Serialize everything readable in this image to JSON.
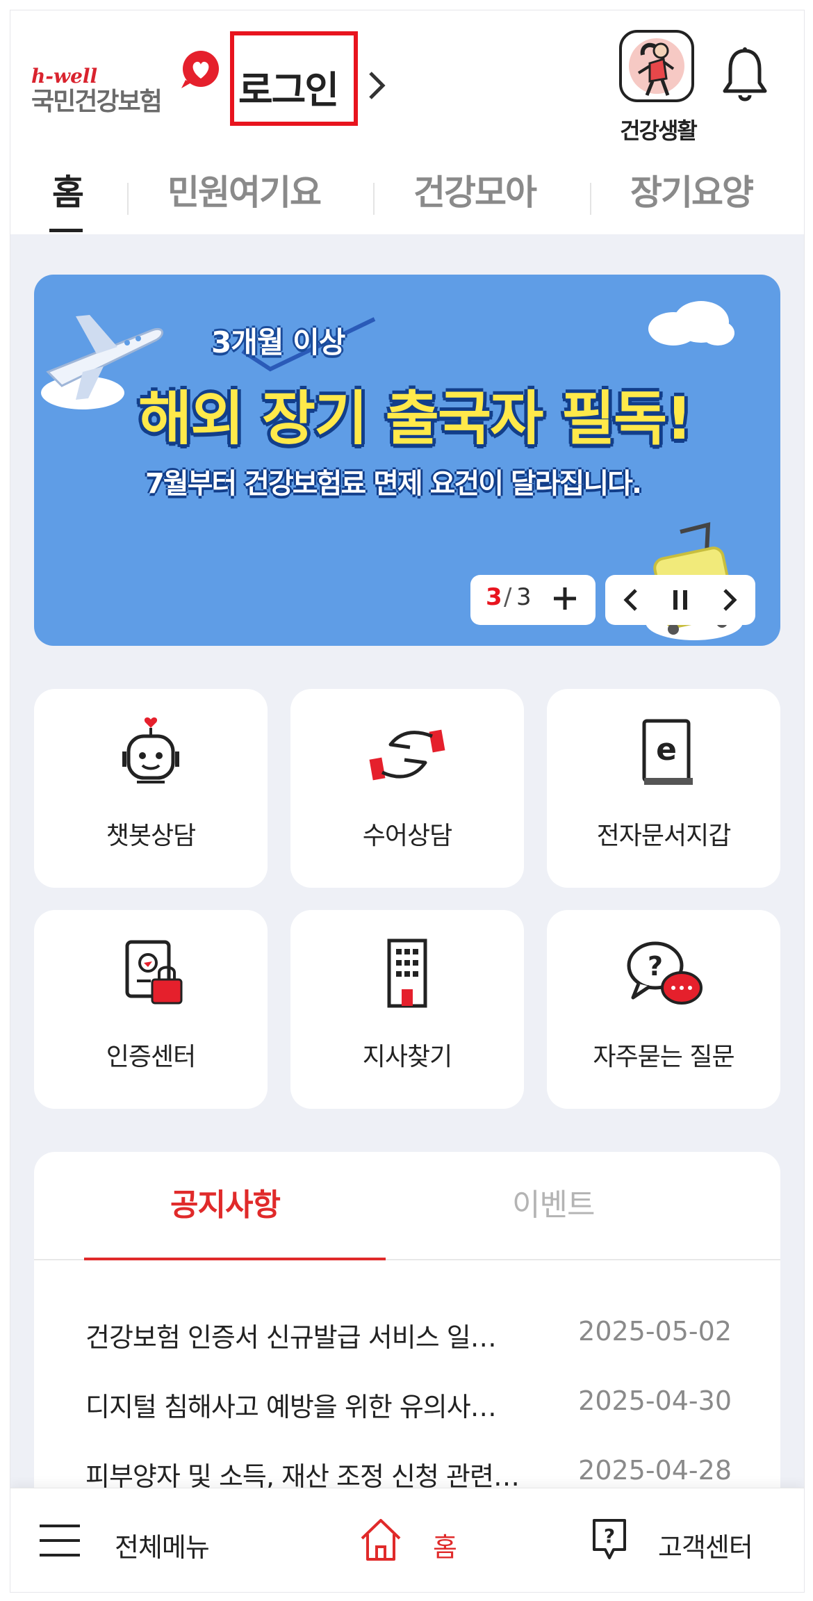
{
  "header": {
    "logo_tagline": "h-well",
    "logo_name": "국민건강보험",
    "login_label": "로그인",
    "health_life_label": "건강생활"
  },
  "tabs": [
    {
      "label": "홈",
      "active": true
    },
    {
      "label": "민원여기요",
      "active": false
    },
    {
      "label": "건강모아",
      "active": false
    },
    {
      "label": "장기요양",
      "active": false
    }
  ],
  "banner": {
    "subtitle": "3개월 이상",
    "title": "해외 장기 출국자 필독!",
    "description": "7월부터 건강보험료 면제 요건이 달라집니다.",
    "current_page": "3",
    "separator": "/",
    "total_pages": "3",
    "background_color": "#5f9de6",
    "title_color": "#ffe94a"
  },
  "quick_menu": [
    {
      "label": "챗봇상담",
      "icon": "chatbot-icon"
    },
    {
      "label": "수어상담",
      "icon": "sign-language-icon"
    },
    {
      "label": "전자문서지갑",
      "icon": "e-document-wallet-icon"
    },
    {
      "label": "인증센터",
      "icon": "certificate-lock-icon"
    },
    {
      "label": "지사찾기",
      "icon": "building-icon"
    },
    {
      "label": "자주묻는 질문",
      "icon": "faq-bubble-icon"
    }
  ],
  "notice": {
    "tabs": [
      {
        "label": "공지사항",
        "active": true
      },
      {
        "label": "이벤트",
        "active": false
      }
    ],
    "items": [
      {
        "title": "건강보험 인증서 신규발급 서비스 일…",
        "date": "2025-05-02"
      },
      {
        "title": "디지털 침해사고 예방을 위한 유의사…",
        "date": "2025-04-30"
      },
      {
        "title": "피부양자 및 소득, 재산 조정 신청 관련…",
        "date": "2025-04-28"
      }
    ]
  },
  "bottom_nav": {
    "menu_label": "전체메뉴",
    "home_label": "홈",
    "support_label": "고객센터"
  },
  "colors": {
    "accent_red": "#e02a2a",
    "login_highlight": "#e8141e",
    "page_background": "#eef0f6"
  }
}
